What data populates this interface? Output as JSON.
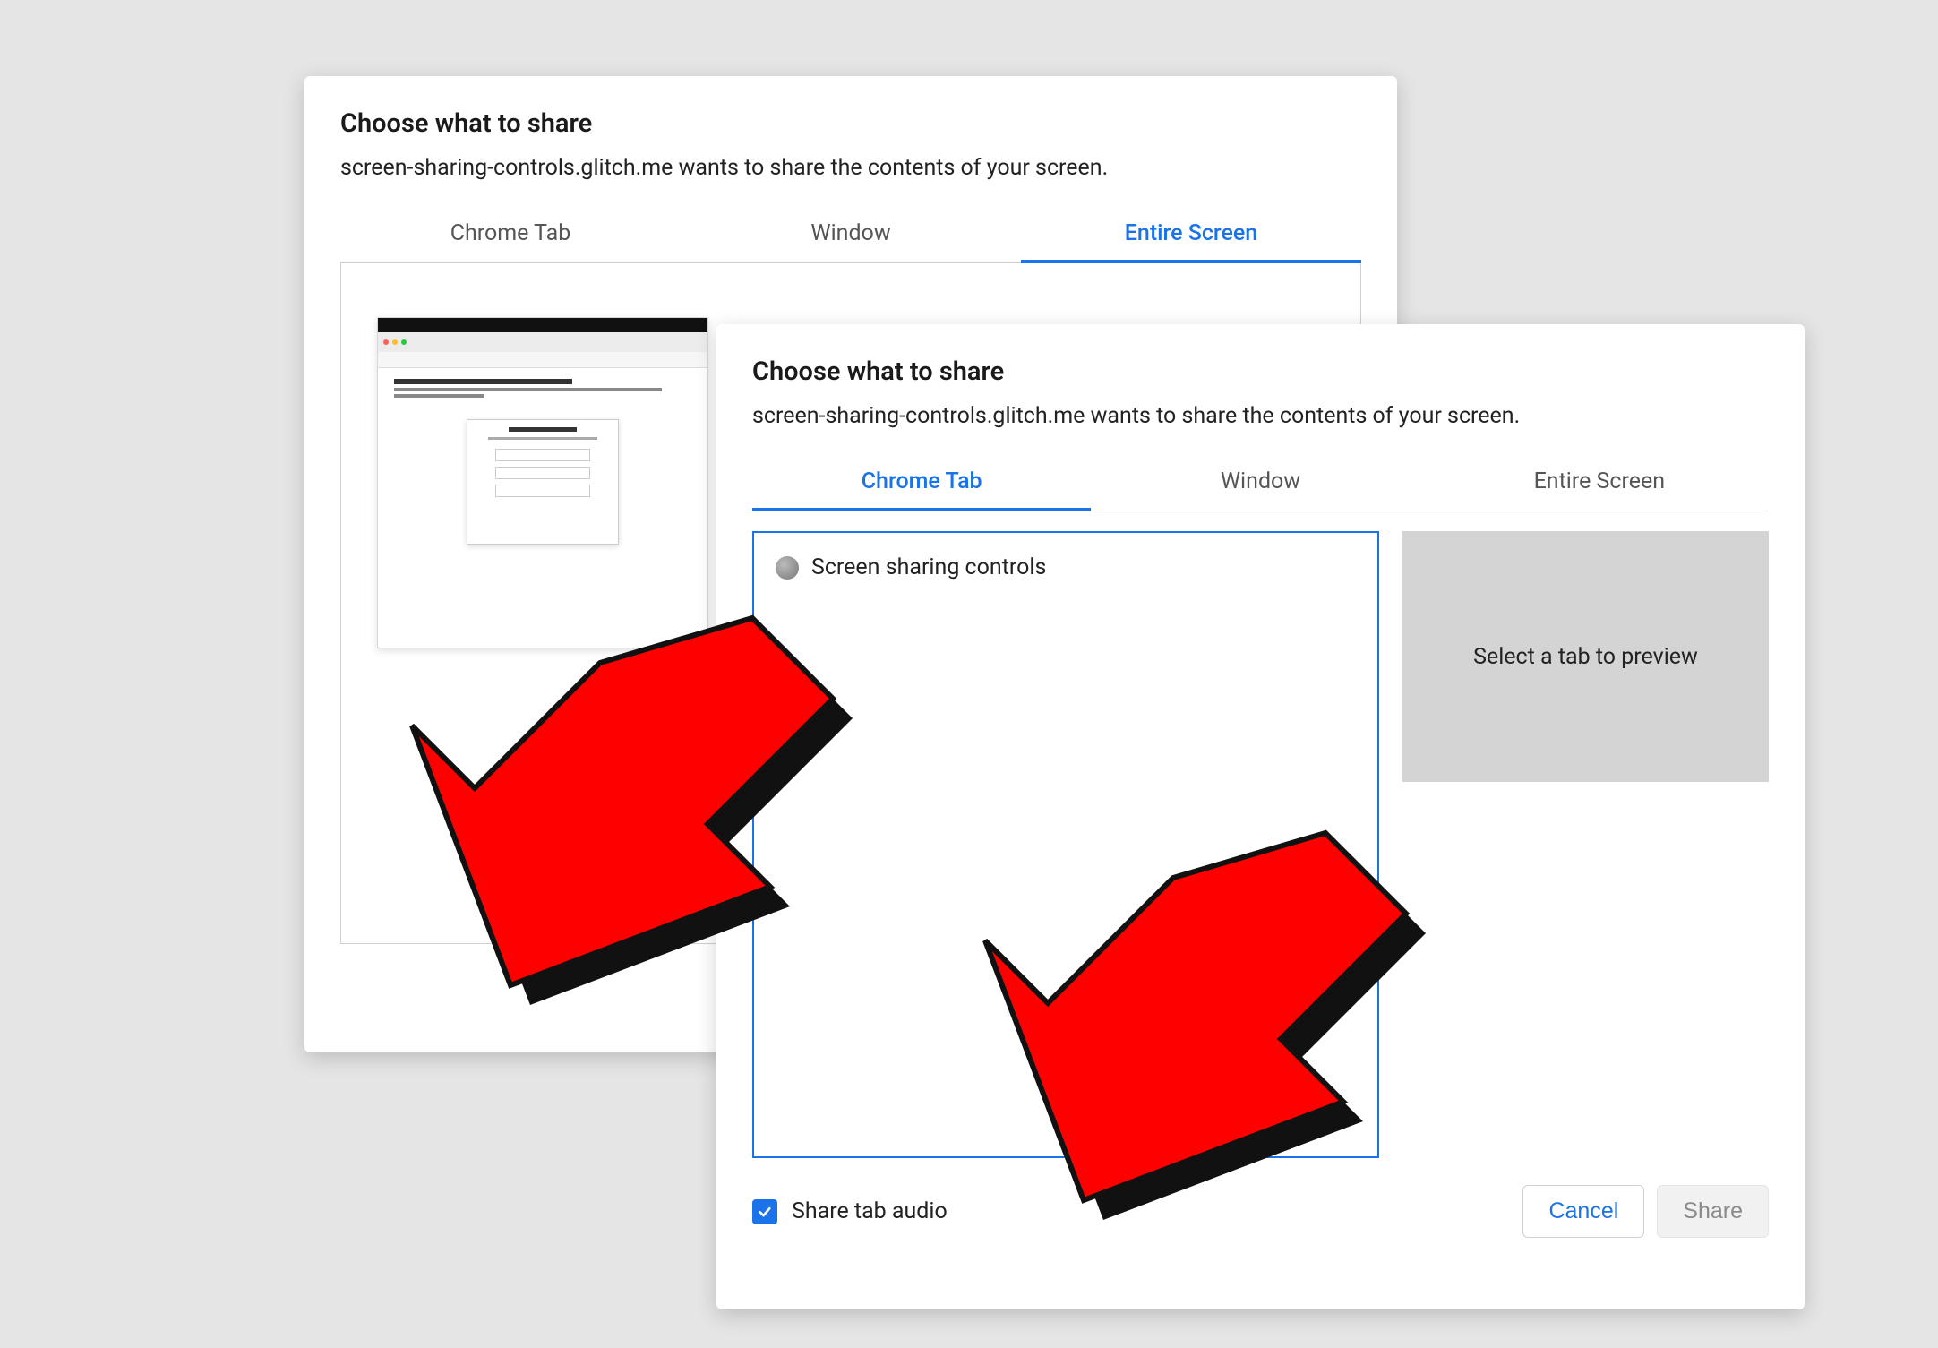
{
  "dialog": {
    "title": "Choose what to share",
    "subtitle": "screen-sharing-controls.glitch.me wants to share the contents of your screen.",
    "tabs": {
      "chrome_tab": "Chrome Tab",
      "window": "Window",
      "entire_screen": "Entire Screen"
    }
  },
  "front": {
    "tab_item_label": "Screen sharing controls",
    "preview_placeholder": "Select a tab to preview",
    "share_audio_label": "Share tab audio",
    "share_audio_checked": true,
    "cancel_label": "Cancel",
    "share_label": "Share"
  },
  "colors": {
    "accent": "#1a73e8",
    "arrow_fill": "#ff0000",
    "arrow_shadow": "#111111"
  }
}
